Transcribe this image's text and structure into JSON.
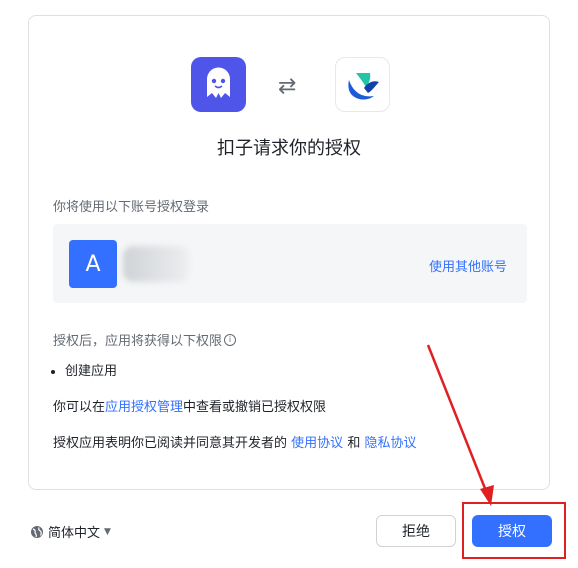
{
  "dialog": {
    "title": "扣子请求你的授权",
    "swap_symbol": "⇄",
    "account_hint": "你将使用以下账号授权登录",
    "account": {
      "avatar_letter": "A",
      "switch_label": "使用其他账号"
    },
    "permissions": {
      "title": "授权后，应用将获得以下权限",
      "items": [
        "创建应用"
      ]
    },
    "manage": {
      "prefix": "你可以在",
      "link": "应用授权管理",
      "suffix": "中查看或撤销已授权权限"
    },
    "agreement": {
      "prefix": "授权应用表明你已阅读并同意其开发者的",
      "terms_link": "使用协议",
      "and": "和",
      "privacy_link": "隐私协议"
    }
  },
  "footer": {
    "language": "简体中文",
    "reject_label": "拒绝",
    "authorize_label": "授权"
  },
  "icons": {
    "left_app": "ghost-app-icon",
    "right_app": "bird-app-icon",
    "language": "globe-icon",
    "info": "info-icon"
  },
  "colors": {
    "primary": "#3370ff",
    "annotation": "#e02020",
    "left_app_bg": "#4e55e8"
  }
}
